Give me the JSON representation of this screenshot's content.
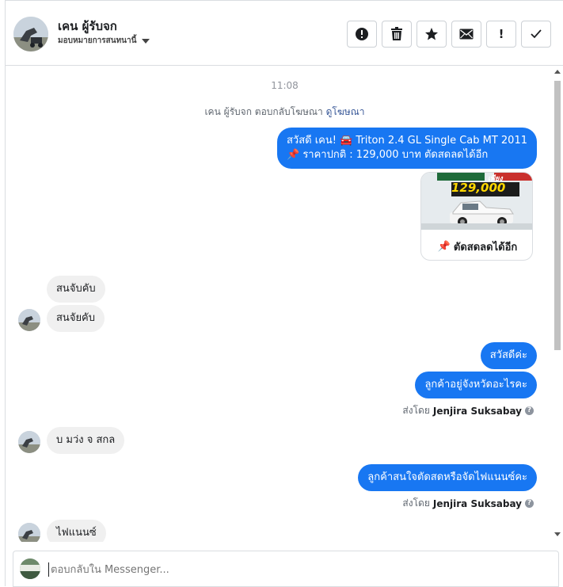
{
  "header": {
    "name": "เคน ผู้รับจก",
    "assign_label": "มอบหมายการสนทนานี้",
    "toolbar": [
      {
        "icon": "alert-circle-icon",
        "label": "!"
      },
      {
        "icon": "trash-icon",
        "label": ""
      },
      {
        "icon": "star-icon",
        "label": ""
      },
      {
        "icon": "envelope-icon",
        "label": ""
      },
      {
        "icon": "exclamation-icon",
        "label": "!"
      },
      {
        "icon": "check-icon",
        "label": "✓"
      }
    ]
  },
  "chat": {
    "timestamp": "11:08",
    "reply_note": "เคน ผู้รับจก ตอบกลับโฆษณา",
    "reply_link": "ดูโฆษณา",
    "ad_message_line1": "สวัสดี เคน! 🚘 Triton 2.4 GL Single Cab MT 2011",
    "ad_message_line2": "📌 ราคาปกติ : 129,000 บาท ตัดสดลดได้อีก",
    "card_price": "129,000",
    "card_price_prefix": "เพียง",
    "card_caption": "ตัดสดลดได้อีก",
    "messages_in_1": [
      "สนจับคับ",
      "สนจัยคับ"
    ],
    "messages_out_1": [
      "สวัสดีค่ะ",
      "ลูกค้าอยู่จังหวัดอะไรคะ"
    ],
    "sender_prefix": "ส่งโดย",
    "sender_name": "Jenjira Suksabay",
    "messages_in_2": "บ มว่ง จ สกล",
    "messages_out_2": "ลูกค้าสนใจตัดสดหรือจัดไฟแนนซ์คะ",
    "messages_in_3": "ไฟแนนซ์"
  },
  "composer": {
    "placeholder": "ตอบกลับใน Messenger..."
  },
  "colors": {
    "accent": "#1877f2",
    "incoming_bubble": "#f0f0f0",
    "link": "#385898"
  }
}
